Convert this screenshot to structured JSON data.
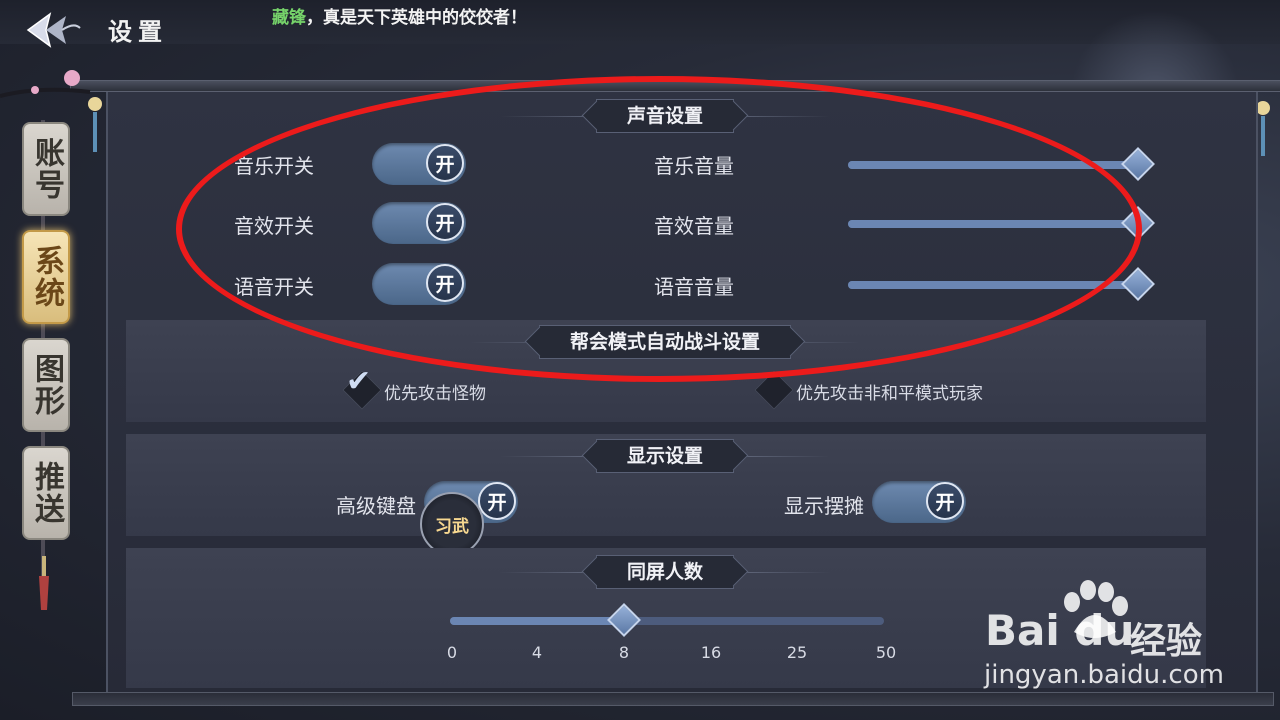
{
  "header": {
    "title": "设置",
    "ticker_speaker": "藏锋",
    "ticker_message": "，真是天下英雄中的佼佼者！"
  },
  "side_tabs": [
    {
      "label": "账号",
      "active": false
    },
    {
      "label": "系统",
      "active": true
    },
    {
      "label": "图形",
      "active": false
    },
    {
      "label": "推送",
      "active": false
    }
  ],
  "sound": {
    "header": "声音设置",
    "toggles": [
      {
        "label": "音乐开关",
        "state": "开"
      },
      {
        "label": "音效开关",
        "state": "开"
      },
      {
        "label": "语音开关",
        "state": "开"
      }
    ],
    "volumes": [
      {
        "label": "音乐音量",
        "level": 1.0
      },
      {
        "label": "音效音量",
        "level": 1.0
      },
      {
        "label": "语音音量",
        "level": 1.0
      }
    ]
  },
  "guild_battle": {
    "header": "帮会模式自动战斗设置",
    "options": [
      {
        "label": "优先攻击怪物",
        "checked": true
      },
      {
        "label": "优先攻击非和平模式玩家",
        "checked": false
      }
    ]
  },
  "display": {
    "header": "显示设置",
    "advanced_keyboard": {
      "label": "高级键盘",
      "state": "开"
    },
    "show_stall": {
      "label": "显示摆摊",
      "state": "开"
    }
  },
  "same_screen": {
    "header": "同屏人数",
    "ticks": [
      "0",
      "4",
      "8",
      "16",
      "25",
      "50"
    ],
    "selected": "8"
  },
  "floating_button": "习武",
  "watermark": {
    "brand": "Bai du",
    "suffix": "经验",
    "url": "jingyan.baidu.com"
  }
}
